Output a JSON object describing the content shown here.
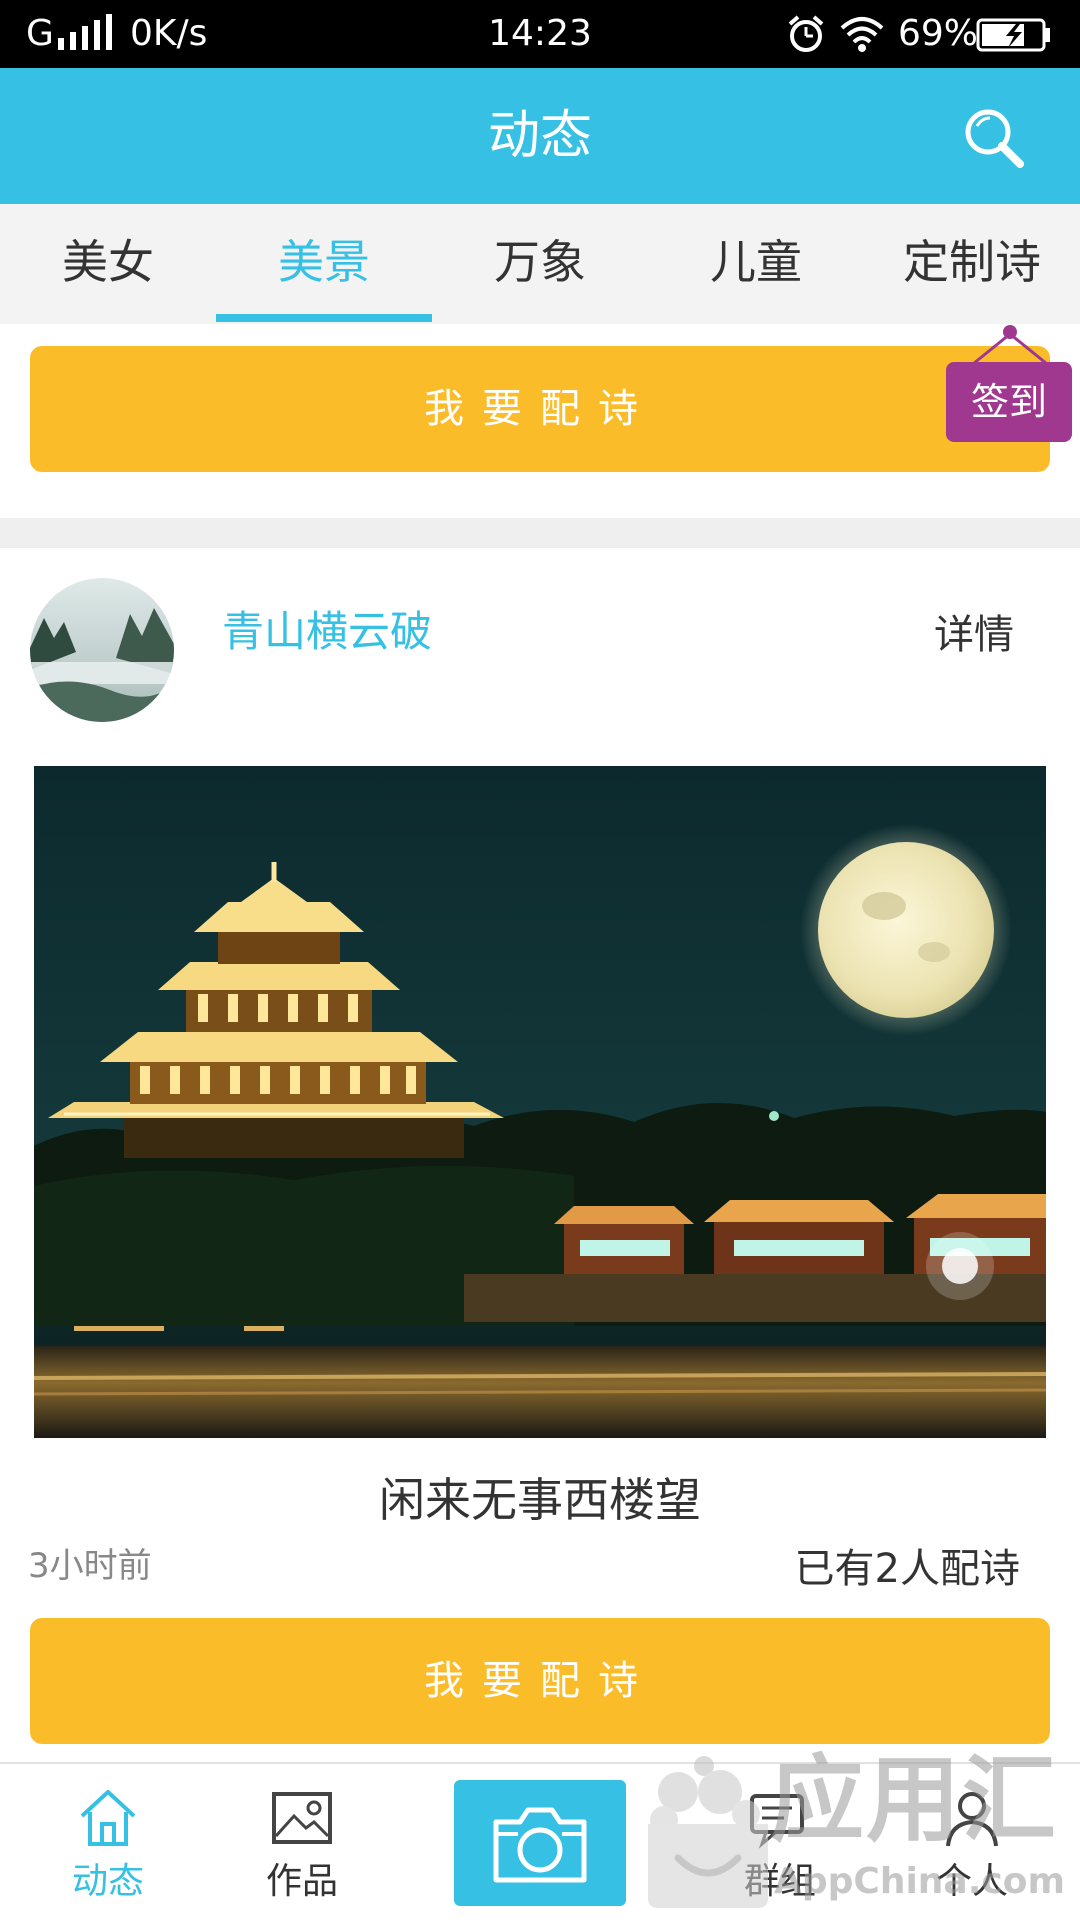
{
  "status_bar": {
    "network": "G",
    "speed": "0K/s",
    "time": "14:23",
    "battery": "69%"
  },
  "header": {
    "title": "动态",
    "icons": [
      "search-icon"
    ]
  },
  "tabs": [
    {
      "label": "美女",
      "active": false
    },
    {
      "label": "美景",
      "active": true
    },
    {
      "label": "万象",
      "active": false
    },
    {
      "label": "儿童",
      "active": false
    },
    {
      "label": "定制诗",
      "active": false
    }
  ],
  "top_action": {
    "label": "我要配诗"
  },
  "checkin": {
    "label": "签到"
  },
  "post": {
    "username": "青山横云破",
    "detail_label": "详情",
    "image_subject": "night-pagoda-full-moon",
    "poem_title": "闲来无事西楼望",
    "time_ago": "3小时前",
    "count_text": "已有2人配诗",
    "action_label": "我要配诗"
  },
  "bottom_nav": [
    {
      "label": "动态",
      "icon": "home-icon",
      "active": true
    },
    {
      "label": "作品",
      "icon": "image-icon",
      "active": false
    },
    {
      "label": "",
      "icon": "camera-icon",
      "active": false
    },
    {
      "label": "群组",
      "icon": "chat-icon",
      "active": false
    },
    {
      "label": "个人",
      "icon": "person-icon",
      "active": false
    }
  ],
  "watermark": {
    "text_cn": "应用汇",
    "text_en": "AppChina.com"
  },
  "colors": {
    "accent": "#35c0e4",
    "action_yellow": "#fbbc2a",
    "checkin_purple": "#a0388f",
    "status_bar": "#000000"
  }
}
